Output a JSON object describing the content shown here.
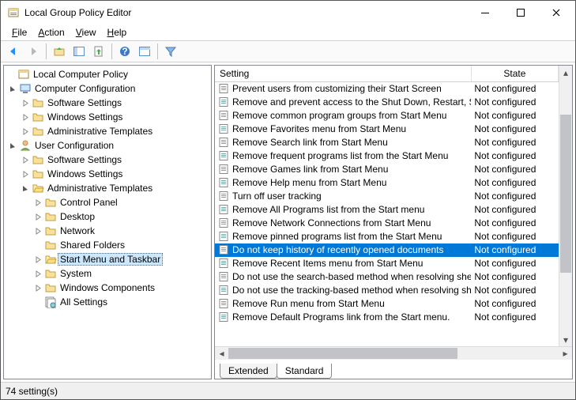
{
  "window": {
    "title": "Local Group Policy Editor"
  },
  "menu": {
    "file": "File",
    "action": "Action",
    "view": "View",
    "help": "Help"
  },
  "tree": {
    "root": "Local Computer Policy",
    "comp": "Computer Configuration",
    "comp_sw": "Software Settings",
    "comp_win": "Windows Settings",
    "comp_adm": "Administrative Templates",
    "user": "User Configuration",
    "user_sw": "Software Settings",
    "user_win": "Windows Settings",
    "user_adm": "Administrative Templates",
    "cp": "Control Panel",
    "desk": "Desktop",
    "net": "Network",
    "sf": "Shared Folders",
    "smt": "Start Menu and Taskbar",
    "sys": "System",
    "wc": "Windows Components",
    "all": "All Settings"
  },
  "columns": {
    "setting": "Setting",
    "state": "State"
  },
  "rows": [
    {
      "s": "Prevent users from customizing their Start Screen",
      "st": "Not configured"
    },
    {
      "s": "Remove and prevent access to the Shut Down, Restart, Sleep, and Hibernate commands",
      "st": "Not configured"
    },
    {
      "s": "Remove common program groups from Start Menu",
      "st": "Not configured"
    },
    {
      "s": "Remove Favorites menu from Start Menu",
      "st": "Not configured"
    },
    {
      "s": "Remove Search link from Start Menu",
      "st": "Not configured"
    },
    {
      "s": "Remove frequent programs list from the Start Menu",
      "st": "Not configured"
    },
    {
      "s": "Remove Games link from Start Menu",
      "st": "Not configured"
    },
    {
      "s": "Remove Help menu from Start Menu",
      "st": "Not configured"
    },
    {
      "s": "Turn off user tracking",
      "st": "Not configured"
    },
    {
      "s": "Remove All Programs list from the Start menu",
      "st": "Not configured"
    },
    {
      "s": "Remove Network Connections from Start Menu",
      "st": "Not configured"
    },
    {
      "s": "Remove pinned programs list from the Start Menu",
      "st": "Not configured"
    },
    {
      "s": "Do not keep history of recently opened documents",
      "st": "Not configured",
      "sel": true
    },
    {
      "s": "Remove Recent Items menu from Start Menu",
      "st": "Not configured"
    },
    {
      "s": "Do not use the search-based method when resolving shell shortcuts",
      "st": "Not configured"
    },
    {
      "s": "Do not use the tracking-based method when resolving shell shortcuts",
      "st": "Not configured"
    },
    {
      "s": "Remove Run menu from Start Menu",
      "st": "Not configured"
    },
    {
      "s": "Remove Default Programs link from the Start menu.",
      "st": "Not configured"
    }
  ],
  "tabs": {
    "extended": "Extended",
    "standard": "Standard"
  },
  "status": "74 setting(s)"
}
